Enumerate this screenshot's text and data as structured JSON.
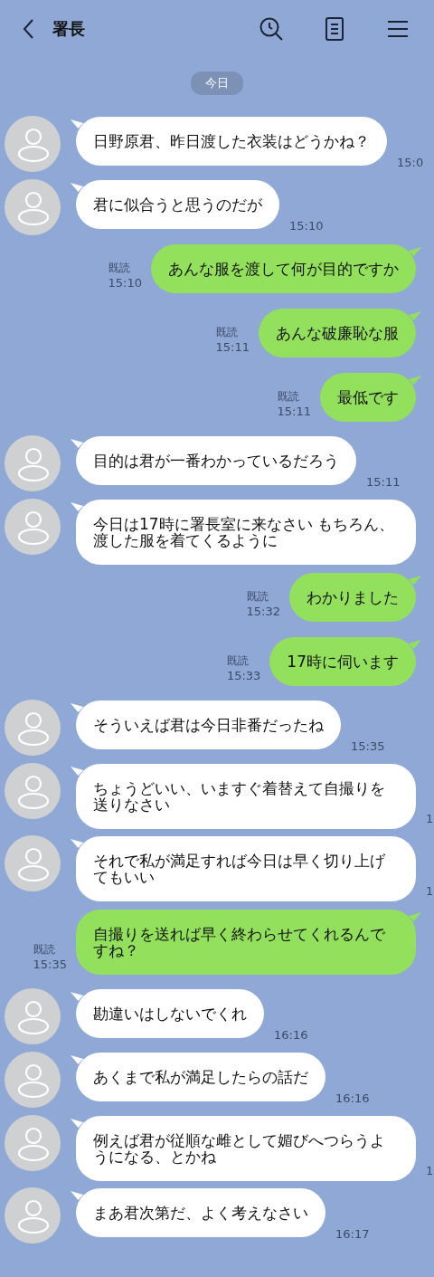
{
  "header": {
    "title": "署長"
  },
  "date_chip": "今日",
  "messages": [
    {
      "kind": "incoming",
      "text": "日野原君、昨日渡した衣装はどうかね？",
      "time": "15:0"
    },
    {
      "kind": "incoming",
      "text": "君に似合うと思うのだが",
      "time": "15:10"
    },
    {
      "kind": "outgoing",
      "text": "あんな服を渡して何が目的ですか",
      "read": "既読",
      "time": "15:10"
    },
    {
      "kind": "outgoing",
      "text": "あんな破廉恥な服",
      "read": "既読",
      "time": "15:11"
    },
    {
      "kind": "outgoing",
      "text": "最低です",
      "read": "既読",
      "time": "15:11"
    },
    {
      "kind": "incoming",
      "text": "目的は君が一番わかっているだろう",
      "time": "15:11"
    },
    {
      "kind": "incoming",
      "text": "今日は17時に署長室に来なさい もちろん、渡した服を着てくるように"
    },
    {
      "kind": "outgoing",
      "text": "わかりました",
      "read": "既読",
      "time": "15:32"
    },
    {
      "kind": "outgoing",
      "text": "17時に伺います",
      "read": "既読",
      "time": "15:33"
    },
    {
      "kind": "incoming",
      "text": "そういえば君は今日非番だったね",
      "time": "15:35"
    },
    {
      "kind": "incoming",
      "text": "ちょうどいい、いますぐ着替えて自撮りを送りなさい",
      "time": "1"
    },
    {
      "kind": "incoming",
      "text": "それで私が満足すれば今日は早く切り上げてもいい",
      "time": "1"
    },
    {
      "kind": "outgoing",
      "text": "自撮りを送れば早く終わらせてくれるんですね？",
      "read": "既読",
      "time": "15:35"
    },
    {
      "kind": "incoming",
      "text": "勘違いはしないでくれ",
      "time": "16:16"
    },
    {
      "kind": "incoming",
      "text": "あくまで私が満足したらの話だ",
      "time": "16:16"
    },
    {
      "kind": "incoming",
      "text": "例えば君が従順な雌として媚びへつらうようになる、とかね",
      "time": "1"
    },
    {
      "kind": "incoming",
      "text": "まあ君次第だ、よく考えなさい",
      "time": "16:17"
    }
  ]
}
